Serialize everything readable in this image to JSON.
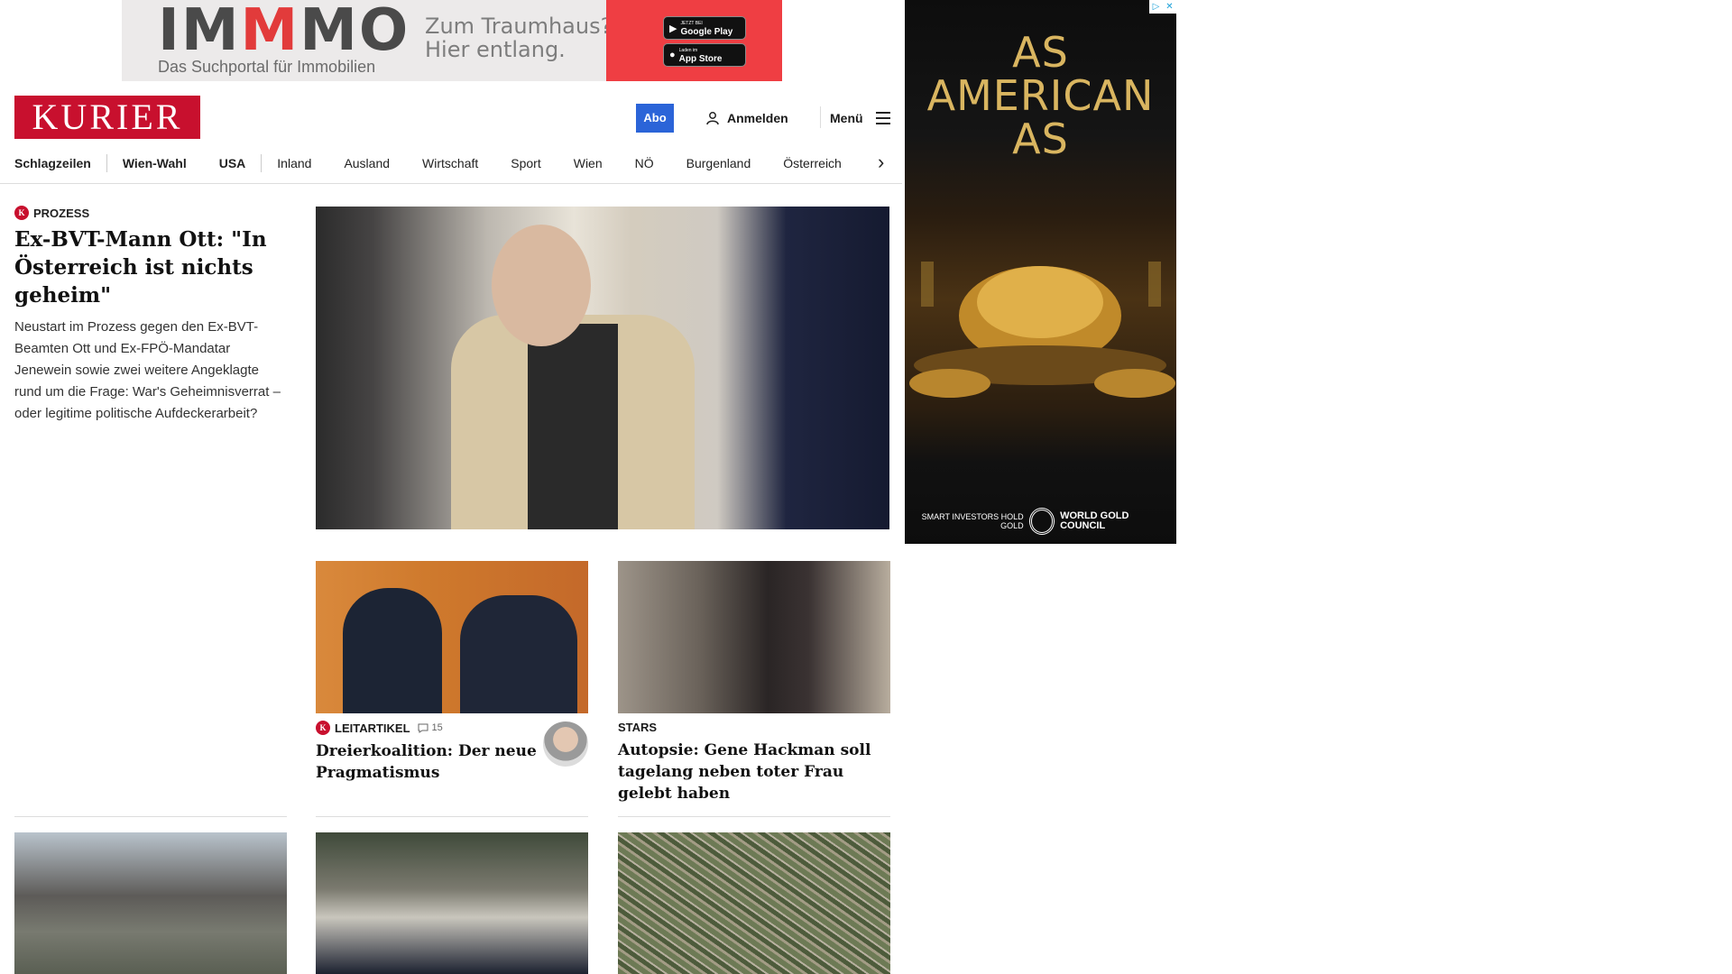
{
  "top_ad": {
    "brand_pre": "IM",
    "brand_red": "M",
    "brand_post": "MO",
    "tagline": "Das Suchportal für Immobilien",
    "claim_line1": "Zum Traumhaus?",
    "claim_line2": "Hier entlang.",
    "google_small": "JETZT BEI",
    "google_label": "Google Play",
    "apple_small": "Laden im",
    "apple_label": "App Store",
    "accent_color": "#ef3e43"
  },
  "side_ad": {
    "headline": "AS AMERICAN AS",
    "footer_small": "SMART INVESTORS HOLD GOLD",
    "footer_brand": "WORLD GOLD COUNCIL",
    "accent_color": "#d9b560"
  },
  "header": {
    "logo": "KURIER",
    "abo": "Abo",
    "login": "Anmelden",
    "menu": "Menü",
    "brand_color": "#c8102e"
  },
  "nav": {
    "items": [
      "Schlagzeilen",
      "Wien-Wahl",
      "USA",
      "Inland",
      "Ausland",
      "Wirtschaft",
      "Sport",
      "Wien",
      "NÖ",
      "Burgenland",
      "Österreich"
    ]
  },
  "lead": {
    "kicker": "PROZESS",
    "kicker_icon": "K",
    "title": "Ex-BVT-Mann Ott: \"In Österreich ist nichts geheim\"",
    "teaser": "Neustart im Prozess gegen den Ex-BVT-Beamten Ott und Ex-FPÖ-Mandatar Jenewein sowie zwei weitere Angeklagte rund um die Frage: War's Geheimnisverrat – oder legitime politische Aufdeckerarbeit?"
  },
  "cards": [
    {
      "kicker": "LEITARTIKEL",
      "kicker_icon": "K",
      "comments": "15",
      "title": "Dreierkoalition: Der neue Pragmatismus"
    },
    {
      "kicker": "STARS",
      "title": "Autopsie: Gene Hackman soll tagelang neben toter Frau gelebt haben"
    }
  ]
}
